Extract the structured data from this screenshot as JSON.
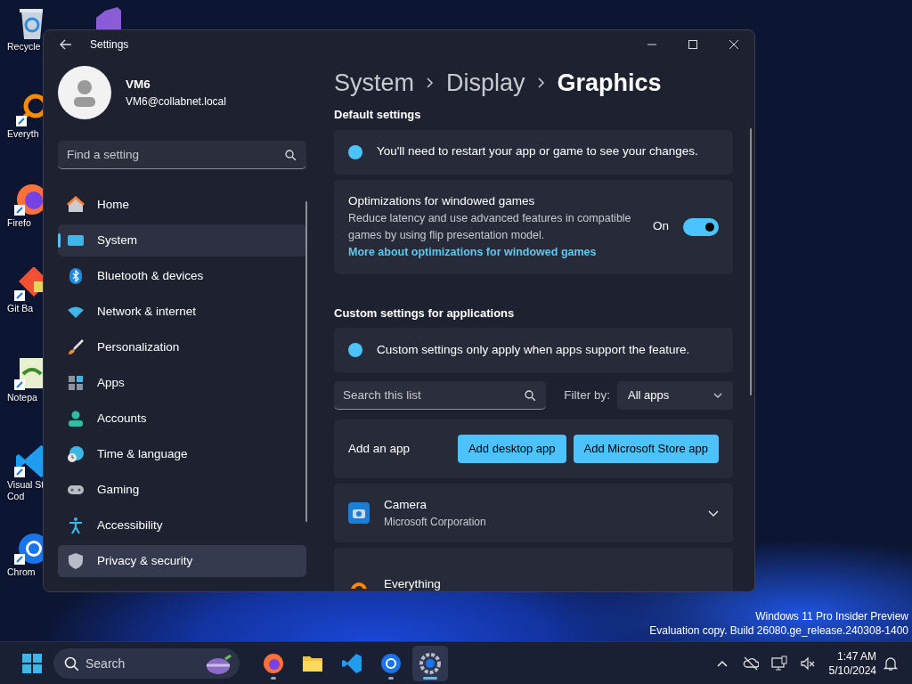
{
  "desktop_icons": [
    {
      "kind": "visualstudio"
    },
    {
      "kind": "recycle",
      "label": [
        "Recycle"
      ]
    },
    {
      "kind": "everything",
      "label": [
        "Everyth"
      ]
    },
    {
      "kind": "firefox",
      "label": [
        "Firefo"
      ]
    },
    {
      "kind": "git",
      "label": [
        "Git Ba"
      ]
    },
    {
      "kind": "notepad",
      "label": [
        "Notepa"
      ]
    },
    {
      "kind": "vscode",
      "label": [
        "Visual St",
        "Cod"
      ]
    },
    {
      "kind": "chrome",
      "label": [
        "Chrom"
      ]
    }
  ],
  "window": {
    "title": "Settings"
  },
  "account": {
    "name": "VM6",
    "email": "VM6@collabnet.local"
  },
  "sidebar": {
    "search": {
      "placeholder": "Find a setting"
    },
    "items": [
      {
        "label": "Home",
        "kind": "home",
        "selected": false,
        "hovered": false
      },
      {
        "label": "System",
        "kind": "system",
        "selected": true,
        "hovered": false
      },
      {
        "label": "Bluetooth & devices",
        "kind": "bluetooth",
        "selected": false,
        "hovered": false
      },
      {
        "label": "Network & internet",
        "kind": "network",
        "selected": false,
        "hovered": false
      },
      {
        "label": "Personalization",
        "kind": "brush",
        "selected": false,
        "hovered": false
      },
      {
        "label": "Apps",
        "kind": "apps",
        "selected": false,
        "hovered": false
      },
      {
        "label": "Accounts",
        "kind": "accounts",
        "selected": false,
        "hovered": false
      },
      {
        "label": "Time & language",
        "kind": "time",
        "selected": false,
        "hovered": false
      },
      {
        "label": "Gaming",
        "kind": "gaming",
        "selected": false,
        "hovered": false
      },
      {
        "label": "Accessibility",
        "kind": "accessibility",
        "selected": false,
        "hovered": false
      },
      {
        "label": "Privacy & security",
        "kind": "shield",
        "selected": false,
        "hovered": true
      }
    ]
  },
  "breadcrumb": [
    "System",
    "Display",
    "Graphics"
  ],
  "default_settings": {
    "title": "Default settings",
    "info": "You'll need to restart your app or game to see your changes.",
    "toggle_card": {
      "title": "Optimizations for windowed games",
      "description": "Reduce latency and use advanced features in compatible games by using flip presentation model.",
      "link": "More about optimizations for windowed games",
      "state_label": "On",
      "on": true
    }
  },
  "custom_settings": {
    "title": "Custom settings for applications",
    "info": "Custom settings only apply when apps support the feature.",
    "search": {
      "placeholder": "Search this list"
    },
    "filter_label": "Filter by:",
    "filter_value": "All apps",
    "add_label": "Add an app",
    "buttons": [
      "Add desktop app",
      "Add Microsoft Store app"
    ],
    "apps": [
      {
        "kind": "camera",
        "name": "Camera",
        "publisher": "Microsoft Corporation",
        "expanded": false
      },
      {
        "kind": "everything",
        "name": "Everything"
      }
    ]
  },
  "build_info": [
    "Windows 11 Pro Insider Preview",
    "Evaluation copy. Build 26080.ge_release.240308-1400"
  ],
  "taskbar": {
    "search": {
      "placeholder": "Search"
    },
    "apps": [
      {
        "kind": "firefox",
        "running": true,
        "selected": false
      },
      {
        "kind": "explorer",
        "running": false,
        "selected": false
      },
      {
        "kind": "vscode",
        "running": false,
        "selected": false
      },
      {
        "kind": "chrome",
        "running": true,
        "selected": false
      },
      {
        "kind": "settings",
        "running": true,
        "selected": true
      }
    ],
    "clock": {
      "time": "1:47 AM",
      "date": "5/10/2024"
    }
  }
}
